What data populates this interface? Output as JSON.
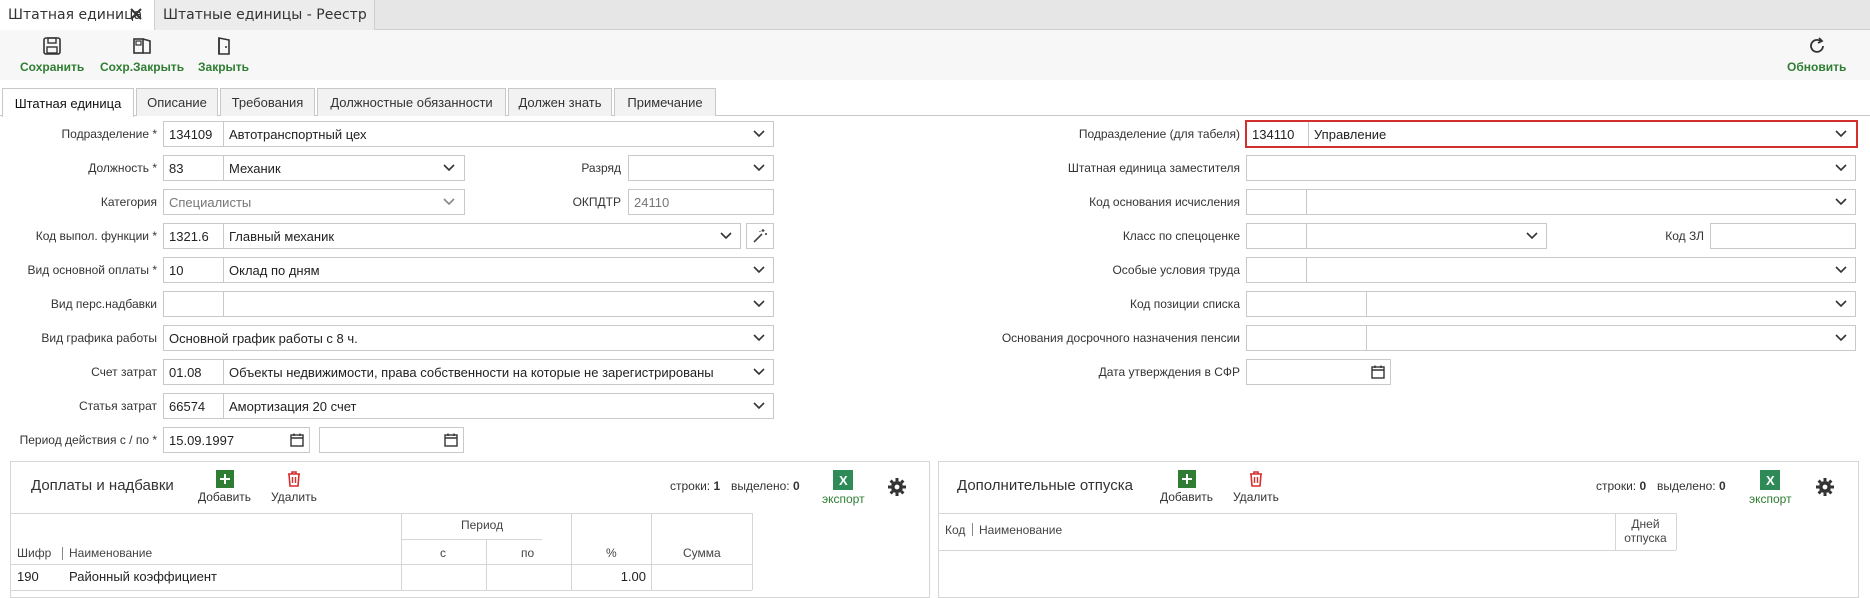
{
  "window_tabs": [
    {
      "label": "Штатная единица"
    },
    {
      "label": "Штатные единицы - Реестр"
    }
  ],
  "toolbar": {
    "save": "Сохранить",
    "save_close": "Сохр.Закрыть",
    "close": "Закрыть",
    "refresh": "Обновить"
  },
  "form_tabs": [
    "Штатная единица",
    "Описание",
    "Требования",
    "Должностные обязанности",
    "Должен знать",
    "Примечание"
  ],
  "left": {
    "podrazdelenie": {
      "label": "Подразделение *",
      "code": "134109",
      "name": "Автотранспортный цех"
    },
    "dolzhnost": {
      "label": "Должность *",
      "code": "83",
      "name": "Механик"
    },
    "razryad": {
      "label": "Разряд",
      "value": ""
    },
    "kategoriya": {
      "label": "Категория",
      "value": "Специалисты"
    },
    "okpdtr": {
      "label": "ОКПДТР",
      "value": "24110"
    },
    "kod_funktsii": {
      "label": "Код выпол. функции *",
      "code": "1321.6",
      "name": "Главный механик"
    },
    "vid_oplaty": {
      "label": "Вид основной оплаты *",
      "code": "10",
      "name": "Оклад по дням"
    },
    "vid_nadbavki": {
      "label": "Вид перс.надбавки",
      "code": "",
      "name": ""
    },
    "grafik": {
      "label": "Вид графика работы",
      "value": "Основной график работы с 8 ч."
    },
    "schet": {
      "label": "Счет затрат",
      "code": "01.08",
      "name": "Объекты недвижимости, права собственности на которые не зарегистрированы"
    },
    "statya": {
      "label": "Статья затрат",
      "code": "66574",
      "name": "Амортизация 20 счет"
    },
    "period": {
      "label": "Период действия с / по *",
      "from": "15.09.1997",
      "to": ""
    }
  },
  "right": {
    "podrazdelenie_tabel": {
      "label": "Подразделение (для табеля)",
      "code": "134110",
      "name": "Управление"
    },
    "zamestitel": {
      "label": "Штатная единица заместителя",
      "value": ""
    },
    "kod_osnovaniya": {
      "label": "Код основания исчисления",
      "code": "",
      "name": ""
    },
    "klass": {
      "label": "Класс по спецоценке",
      "code": "",
      "name": ""
    },
    "kod_zl": {
      "label": "Код ЗЛ",
      "value": ""
    },
    "usloviya": {
      "label": "Особые условия труда",
      "code": "",
      "name": ""
    },
    "kod_pozicii": {
      "label": "Код позиции списка",
      "code": "",
      "name": ""
    },
    "osnovaniya": {
      "label": "Основания досрочного назначения пенсии",
      "code": "",
      "name": ""
    },
    "data_sfr": {
      "label": "Дата утверждения в СФР",
      "value": ""
    }
  },
  "panel_left": {
    "title": "Доплаты и надбавки",
    "add": "Добавить",
    "delete": "Удалить",
    "rows_label": "строки:",
    "rows_value": "1",
    "sel_label": "выделено:",
    "sel_value": "0",
    "export": "экспорт",
    "headers": {
      "shifr": "Шифр",
      "name": "Наименование",
      "period": "Период",
      "from": "с",
      "to": "по",
      "pct": "%",
      "sum": "Сумма"
    },
    "rows": [
      {
        "shifr": "190",
        "name": "Районный коэффициент",
        "from": "",
        "to": "",
        "pct": "1.00",
        "sum": ""
      }
    ]
  },
  "panel_right": {
    "title": "Дополнительные отпуска",
    "add": "Добавить",
    "delete": "Удалить",
    "rows_label": "строки:",
    "rows_value": "0",
    "sel_label": "выделено:",
    "sel_value": "0",
    "export": "экспорт",
    "headers": {
      "kod": "Код",
      "name": "Наименование",
      "days_1": "Дней",
      "days_2": "отпуска"
    }
  }
}
